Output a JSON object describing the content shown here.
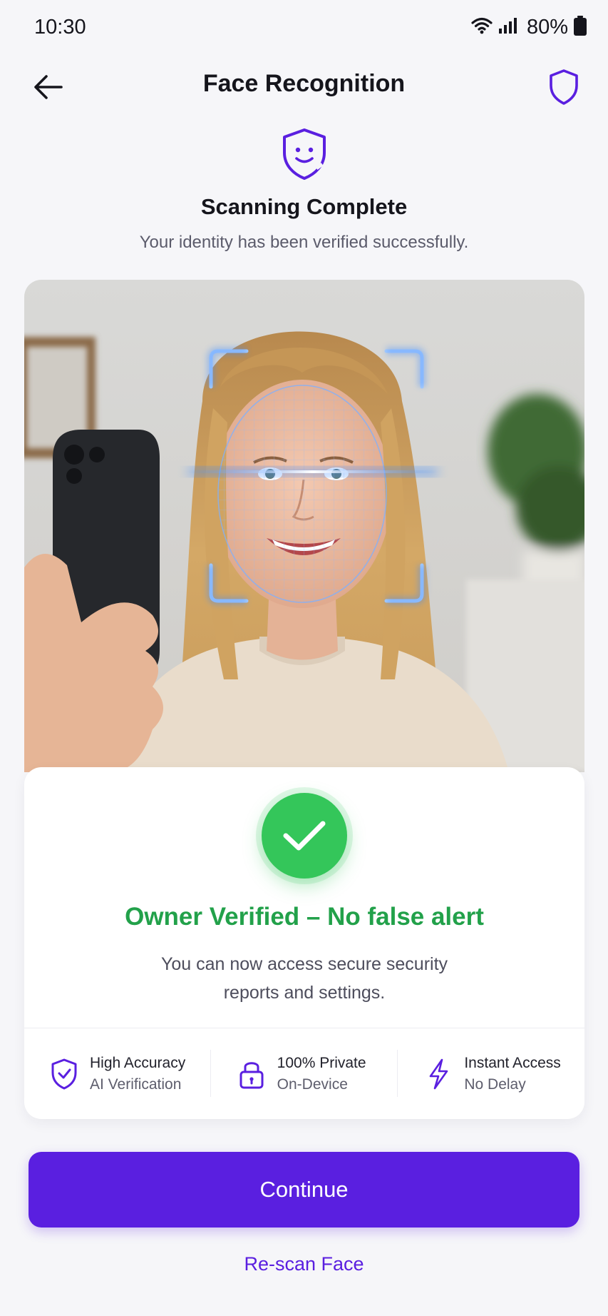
{
  "status_bar": {
    "time": "10:30",
    "battery_percent": "80%",
    "icons": [
      "wifi-icon",
      "signal-icon",
      "battery-icon"
    ]
  },
  "header": {
    "title": "Face Recognition",
    "back_icon": "arrow-left-icon",
    "action_icon": "shield-icon"
  },
  "scan": {
    "icon": "shield-face-icon",
    "title": "Scanning Complete",
    "subtitle": "Your identity has been verified successfully."
  },
  "result": {
    "icon": "check-icon",
    "title": "Owner Verified – No false alert",
    "description": "You can now access secure security reports and settings."
  },
  "features": [
    {
      "icon": "shield-check-icon",
      "title": "High Accuracy",
      "subtitle": "AI Verification"
    },
    {
      "icon": "lock-icon",
      "title": "100% Private",
      "subtitle": "On-Device"
    },
    {
      "icon": "lightning-icon",
      "title": "Instant Access",
      "subtitle": "No Delay"
    }
  ],
  "actions": {
    "primary": "Continue",
    "secondary": "Re-scan Face"
  },
  "colors": {
    "primary": "#5a1fe0",
    "success": "#34c65a",
    "success_text": "#22a14a",
    "scan_glow": "#3d8bff"
  }
}
